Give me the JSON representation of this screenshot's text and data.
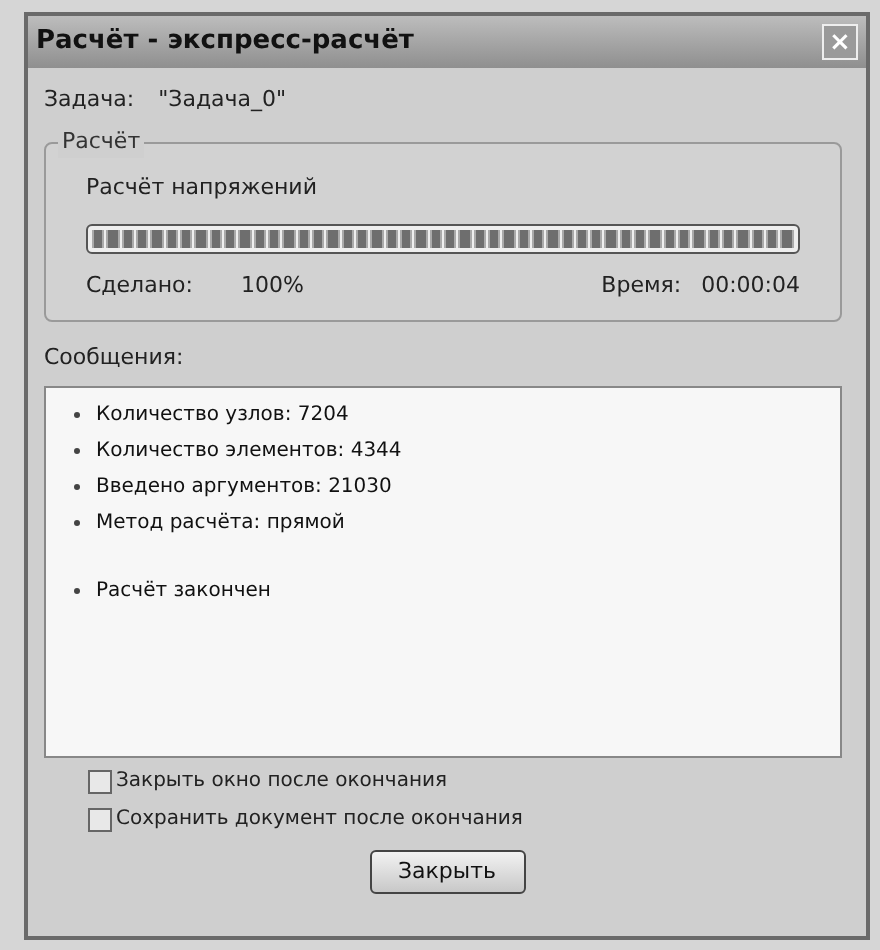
{
  "window": {
    "title": "Расчёт - экспресс-расчёт",
    "close": "×"
  },
  "task": {
    "label": "Задача:",
    "value": "\"Задача_0\""
  },
  "calc_group": {
    "title": "Расчёт",
    "stage": "Расчёт напряжений",
    "level": 1,
    "done_label": "Сделано:",
    "done_value": "100%",
    "time_label": "Время:",
    "time_value": "00:00:04"
  },
  "messages": {
    "label": "Сообщения:",
    "groups": [
      [
        "Количество узлов: 7204",
        "Количество элементов: 4344",
        "Введено аргументов: 21030",
        "Метод расчёта: прямой"
      ],
      [
        "Расчёт закончен"
      ]
    ]
  },
  "options": [
    {
      "label": "Закрыть окно после окончания",
      "checked": false
    },
    {
      "label": "Сохранить документ после окончания",
      "checked": false
    }
  ],
  "buttons": [
    "Закрыть"
  ]
}
